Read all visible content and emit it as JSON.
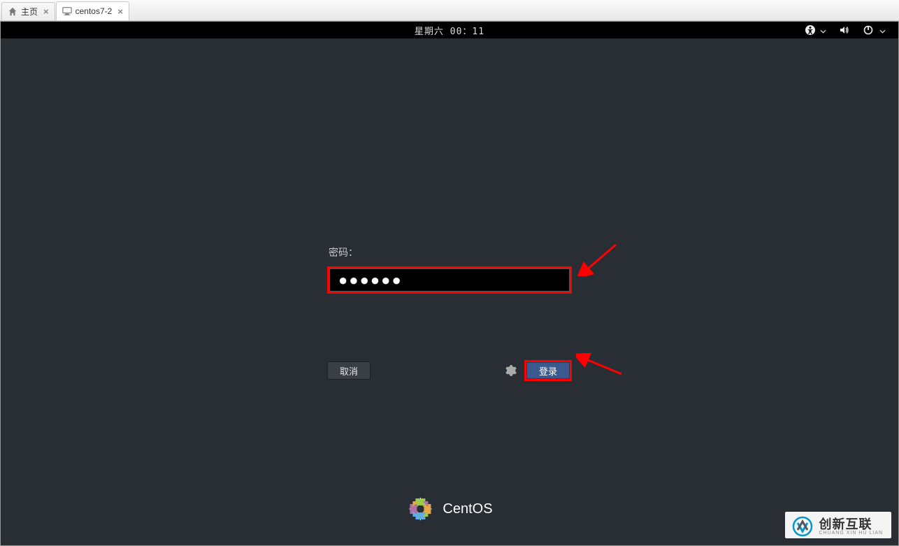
{
  "tabs": [
    {
      "label": "主页",
      "active": false
    },
    {
      "label": "centos7-2",
      "active": true
    }
  ],
  "topbar": {
    "datetime": "星期六 00：11"
  },
  "login": {
    "password_label": "密码：",
    "password_value": "●●●●●●",
    "cancel_label": "取消",
    "login_label": "登录"
  },
  "brand": {
    "name": "CentOS"
  },
  "watermark": {
    "main": "创新互联",
    "sub": "CHUANG XIN HU LIAN"
  }
}
